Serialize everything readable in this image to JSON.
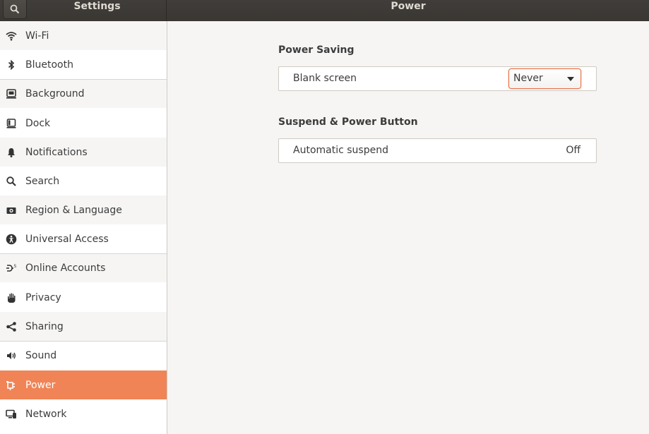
{
  "header": {
    "app_title": "Settings",
    "panel_title": "Power",
    "search_icon": "search-icon"
  },
  "sidebar": {
    "items": [
      {
        "label": "Wi-Fi",
        "icon": "wifi-icon"
      },
      {
        "label": "Bluetooth",
        "icon": "bluetooth-icon"
      },
      {
        "label": "Background",
        "icon": "background-icon"
      },
      {
        "label": "Dock",
        "icon": "dock-icon"
      },
      {
        "label": "Notifications",
        "icon": "bell-icon"
      },
      {
        "label": "Search",
        "icon": "search-icon"
      },
      {
        "label": "Region & Language",
        "icon": "camera-icon"
      },
      {
        "label": "Universal Access",
        "icon": "accessibility-icon"
      },
      {
        "label": "Online Accounts",
        "icon": "online-accounts-icon"
      },
      {
        "label": "Privacy",
        "icon": "hand-icon"
      },
      {
        "label": "Sharing",
        "icon": "share-icon"
      },
      {
        "label": "Sound",
        "icon": "speaker-icon"
      },
      {
        "label": "Power",
        "icon": "power-plug-icon",
        "selected": true
      },
      {
        "label": "Network",
        "icon": "network-icon"
      }
    ]
  },
  "power": {
    "power_saving": {
      "title": "Power Saving",
      "blank_screen_label": "Blank screen",
      "blank_screen_value": "Never"
    },
    "suspend": {
      "title": "Suspend & Power Button",
      "automatic_suspend_label": "Automatic suspend",
      "automatic_suspend_value": "Off"
    }
  },
  "colors": {
    "accent": "#f08456",
    "headerbar": "#3c3a36",
    "sidebar_bg": "#ffffff",
    "content_bg": "#f6f5f4"
  }
}
